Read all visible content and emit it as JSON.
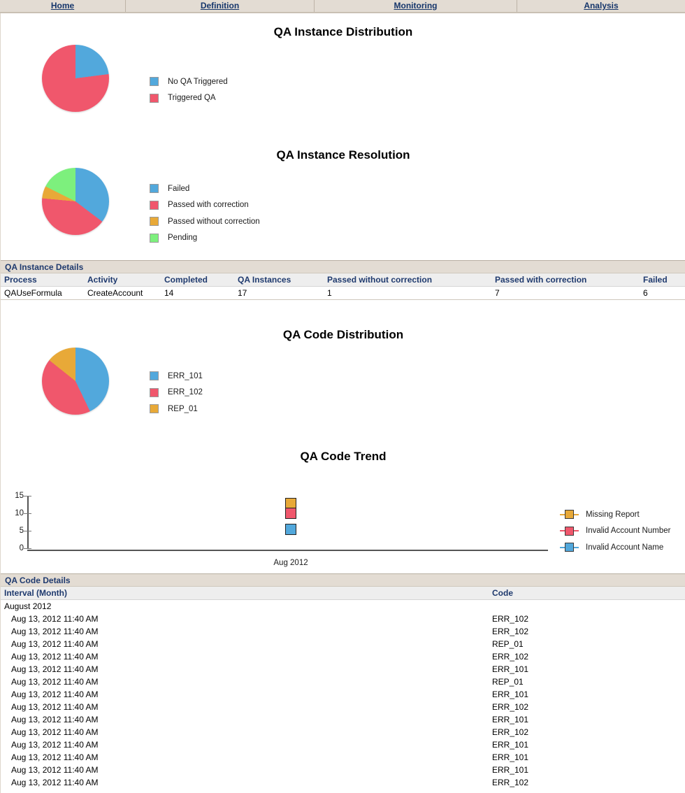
{
  "tabs": [
    {
      "label": "Home",
      "name": "tab-home"
    },
    {
      "label": "Definition",
      "name": "tab-definition"
    },
    {
      "label": "Monitoring",
      "name": "tab-monitoring"
    },
    {
      "label": "Analysis",
      "name": "tab-analysis"
    }
  ],
  "colors": {
    "blue": "#52a8dc",
    "red": "#f0576c",
    "orange": "#e8a938",
    "green": "#7df07d",
    "header_tan": "#e3dcd3",
    "header_navy": "#1f3a6e"
  },
  "sections": {
    "instance_distribution": {
      "title": "QA Instance Distribution",
      "legend": [
        {
          "label": "No QA Triggered",
          "color": "#52a8dc"
        },
        {
          "label": "Triggered QA",
          "color": "#f0576c"
        }
      ]
    },
    "instance_resolution": {
      "title": "QA Instance Resolution",
      "legend": [
        {
          "label": "Failed",
          "color": "#52a8dc"
        },
        {
          "label": "Passed with correction",
          "color": "#f0576c"
        },
        {
          "label": "Passed without correction",
          "color": "#e8a938"
        },
        {
          "label": "Pending",
          "color": "#7df07d"
        }
      ]
    },
    "code_distribution": {
      "title": "QA Code Distribution",
      "legend": [
        {
          "label": "ERR_101",
          "color": "#52a8dc"
        },
        {
          "label": "ERR_102",
          "color": "#f0576c"
        },
        {
          "label": "REP_01",
          "color": "#e8a938"
        }
      ]
    },
    "code_trend": {
      "title": "QA Code Trend",
      "y_ticks": [
        "15",
        "10",
        "5",
        "0"
      ],
      "x_tick": "Aug 2012",
      "legend": [
        {
          "label": "Missing Report",
          "color": "#e8a938"
        },
        {
          "label": "Invalid Account Number",
          "color": "#f0576c"
        },
        {
          "label": "Invalid Account Name",
          "color": "#52a8dc"
        }
      ]
    }
  },
  "instance_details": {
    "caption": "QA Instance Details",
    "columns": [
      "Process",
      "Activity",
      "Completed",
      "QA Instances",
      "Passed without correction",
      "Passed with correction",
      "Failed"
    ],
    "rows": [
      [
        "QAUseFormula",
        "CreateAccount",
        "14",
        "17",
        "1",
        "7",
        "6"
      ]
    ]
  },
  "code_details": {
    "caption": "QA Code Details",
    "columns": [
      "Interval (Month)",
      "Code"
    ],
    "group_label": "August 2012",
    "rows": [
      [
        "Aug 13, 2012 11:40 AM",
        "ERR_102"
      ],
      [
        "Aug 13, 2012 11:40 AM",
        "ERR_102"
      ],
      [
        "Aug 13, 2012 11:40 AM",
        "REP_01"
      ],
      [
        "Aug 13, 2012 11:40 AM",
        "ERR_102"
      ],
      [
        "Aug 13, 2012 11:40 AM",
        "ERR_101"
      ],
      [
        "Aug 13, 2012 11:40 AM",
        "REP_01"
      ],
      [
        "Aug 13, 2012 11:40 AM",
        "ERR_101"
      ],
      [
        "Aug 13, 2012 11:40 AM",
        "ERR_102"
      ],
      [
        "Aug 13, 2012 11:40 AM",
        "ERR_101"
      ],
      [
        "Aug 13, 2012 11:40 AM",
        "ERR_102"
      ],
      [
        "Aug 13, 2012 11:40 AM",
        "ERR_101"
      ],
      [
        "Aug 13, 2012 11:40 AM",
        "ERR_101"
      ],
      [
        "Aug 13, 2012 11:40 AM",
        "ERR_101"
      ],
      [
        "Aug 13, 2012 11:40 AM",
        "ERR_102"
      ]
    ]
  },
  "chart_data": [
    {
      "type": "pie",
      "title": "QA Instance Distribution",
      "labels": [
        "No QA Triggered",
        "Triggered QA"
      ],
      "values": [
        23,
        77
      ],
      "colors": [
        "#52a8dc",
        "#f0576c"
      ],
      "legend_position": "right"
    },
    {
      "type": "pie",
      "title": "QA Instance Resolution",
      "labels": [
        "Failed",
        "Passed with correction",
        "Passed without correction",
        "Pending"
      ],
      "values": [
        6,
        7,
        1,
        3
      ],
      "colors": [
        "#52a8dc",
        "#f0576c",
        "#e8a938",
        "#7df07d"
      ],
      "legend_position": "right"
    },
    {
      "type": "pie",
      "title": "QA Code Distribution",
      "labels": [
        "ERR_101",
        "ERR_102",
        "REP_01"
      ],
      "values": [
        6,
        6,
        2
      ],
      "colors": [
        "#52a8dc",
        "#f0576c",
        "#e8a938"
      ],
      "legend_position": "right"
    },
    {
      "type": "line",
      "title": "QA Code Trend",
      "x": [
        "Aug 2012"
      ],
      "xlabel": "",
      "ylabel": "",
      "ylim": [
        0,
        15
      ],
      "yticks": [
        0,
        5,
        10,
        15
      ],
      "grid": false,
      "legend_position": "right",
      "series": [
        {
          "name": "Missing Report",
          "color": "#e8a938",
          "values": [
            14
          ]
        },
        {
          "name": "Invalid Account Number",
          "color": "#f0576c",
          "values": [
            12
          ]
        },
        {
          "name": "Invalid Account Name",
          "color": "#52a8dc",
          "values": [
            6
          ]
        }
      ]
    }
  ]
}
